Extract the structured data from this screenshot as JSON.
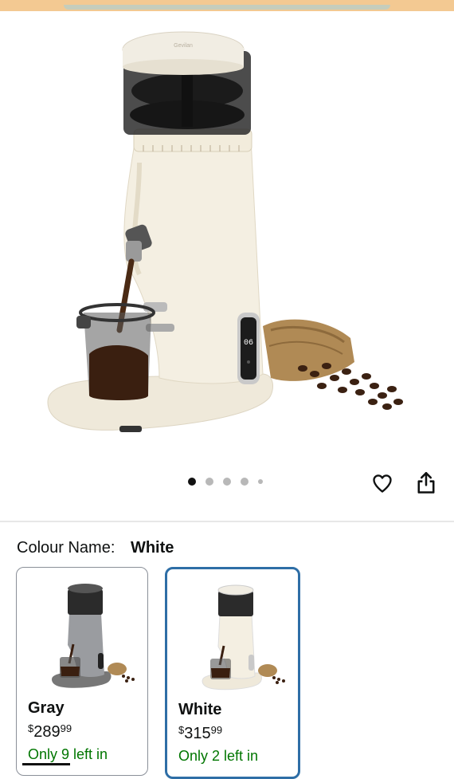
{
  "product": {
    "image_alt": "Electric coffee grinder, white",
    "display_reading": "06",
    "brand_mark": "Gevilan"
  },
  "carousel": {
    "dot_count": 5,
    "active_index": 0
  },
  "actions": {
    "favorite_icon": "heart-icon",
    "share_icon": "share-icon"
  },
  "variation": {
    "label": "Colour Name:",
    "selected": "White",
    "options": [
      {
        "name": "Gray",
        "currency": "$",
        "price_whole": "289",
        "price_fraction": "99",
        "stock": "Only 9 left in",
        "selected": false
      },
      {
        "name": "White",
        "currency": "$",
        "price_whole": "315",
        "price_fraction": "99",
        "stock": "Only 2 left in",
        "selected": true
      }
    ]
  },
  "colors": {
    "selected_border": "#2e6ea6",
    "stock_green": "#007600",
    "top_strip": "#f3c992"
  }
}
